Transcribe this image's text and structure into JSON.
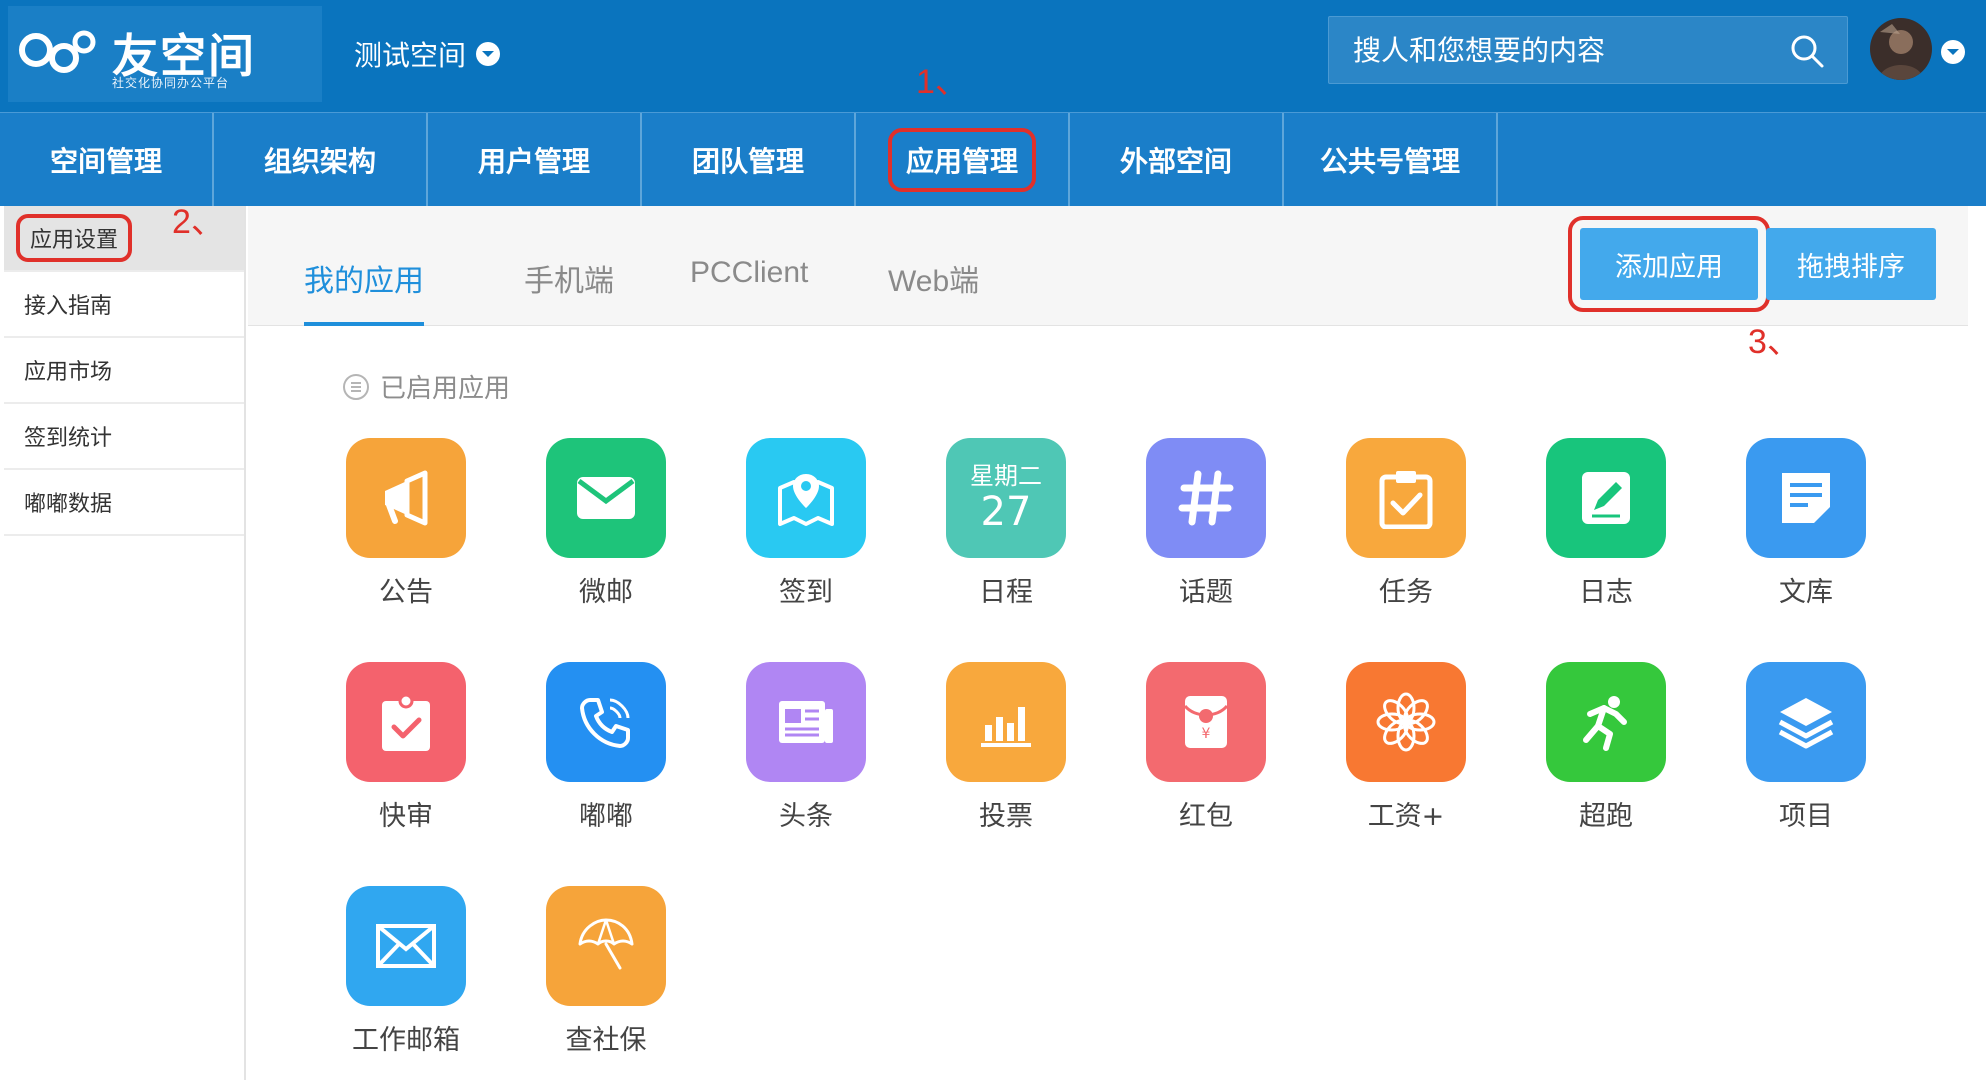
{
  "header": {
    "logo_name": "友空间",
    "logo_sub": "社交化协同办公平台",
    "space_name": "测试空间",
    "search_placeholder": "搜人和您想要的内容"
  },
  "nav": {
    "items": [
      "空间管理",
      "组织架构",
      "用户管理",
      "团队管理",
      "应用管理",
      "外部空间",
      "公共号管理"
    ],
    "active": "应用管理"
  },
  "annotations": [
    "1、",
    "2、",
    "3、"
  ],
  "sidebar": {
    "items": [
      "应用设置",
      "接入指南",
      "应用市场",
      "签到统计",
      "嘟嘟数据"
    ],
    "active": "应用设置"
  },
  "tabs": [
    "我的应用",
    "手机端",
    "PCClient",
    "Web端"
  ],
  "buttons": {
    "add": "添加应用",
    "sort": "拖拽排序"
  },
  "section_title": "已启用应用",
  "apps": [
    {
      "name": "公告",
      "color": "#f6a43a",
      "icon": "megaphone-icon"
    },
    {
      "name": "微邮",
      "color": "#1ec47a",
      "icon": "envelope-icon"
    },
    {
      "name": "签到",
      "color": "#29c9f2",
      "icon": "map-pin-icon"
    },
    {
      "name": "日程",
      "color": "#4fc7b5",
      "icon": "calendar-icon",
      "calendar_weekday": "星期二",
      "calendar_day": "27"
    },
    {
      "name": "话题",
      "color": "#7f8cf5",
      "icon": "hashtag-icon"
    },
    {
      "name": "任务",
      "color": "#f8a83d",
      "icon": "clipboard-check-icon"
    },
    {
      "name": "日志",
      "color": "#18c57c",
      "icon": "edit-note-icon"
    },
    {
      "name": "文库",
      "color": "#3a9af0",
      "icon": "document-icon"
    },
    {
      "name": "快审",
      "color": "#f4626d",
      "icon": "approval-icon"
    },
    {
      "name": "嘟嘟",
      "color": "#2490f2",
      "icon": "phone-call-icon"
    },
    {
      "name": "头条",
      "color": "#b086f3",
      "icon": "newspaper-icon"
    },
    {
      "name": "投票",
      "color": "#f8a83d",
      "icon": "bar-chart-icon"
    },
    {
      "name": "红包",
      "color": "#f36a6f",
      "icon": "red-envelope-icon"
    },
    {
      "name": "工资+",
      "color": "#f87832",
      "icon": "flower-icon"
    },
    {
      "name": "超跑",
      "color": "#35c83c",
      "icon": "runner-icon"
    },
    {
      "name": "项目",
      "color": "#3a9af0",
      "icon": "layers-icon"
    },
    {
      "name": "工作邮箱",
      "color": "#30a7f0",
      "icon": "mail-icon"
    },
    {
      "name": "查社保",
      "color": "#f6a43a",
      "icon": "umbrella-icon"
    }
  ]
}
